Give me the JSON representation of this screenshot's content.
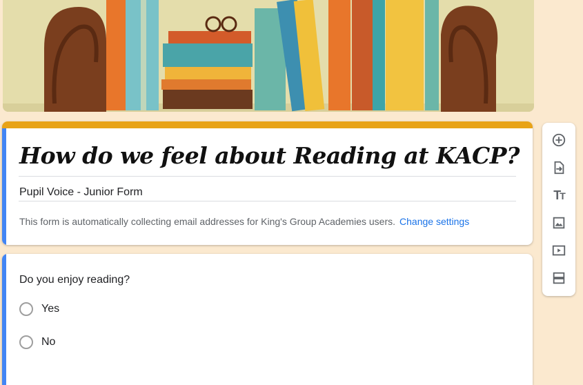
{
  "form": {
    "title": "How do we feel about Reading at KACP?",
    "description": "Pupil Voice - Junior Form",
    "notice": "This form is automatically collecting email addresses for King's Group Academies users.",
    "change_settings": "Change settings"
  },
  "question": {
    "text": "Do you enjoy reading?",
    "options": [
      "Yes",
      "No"
    ]
  },
  "toolbar": {
    "items": [
      "add-question-icon",
      "import-questions-icon",
      "add-title-icon",
      "add-image-icon",
      "add-video-icon",
      "add-section-icon"
    ]
  },
  "colors": {
    "background": "#fbe9cf",
    "theme_bar": "#e8a317",
    "accent": "#4285f4",
    "link": "#1a73e8"
  }
}
